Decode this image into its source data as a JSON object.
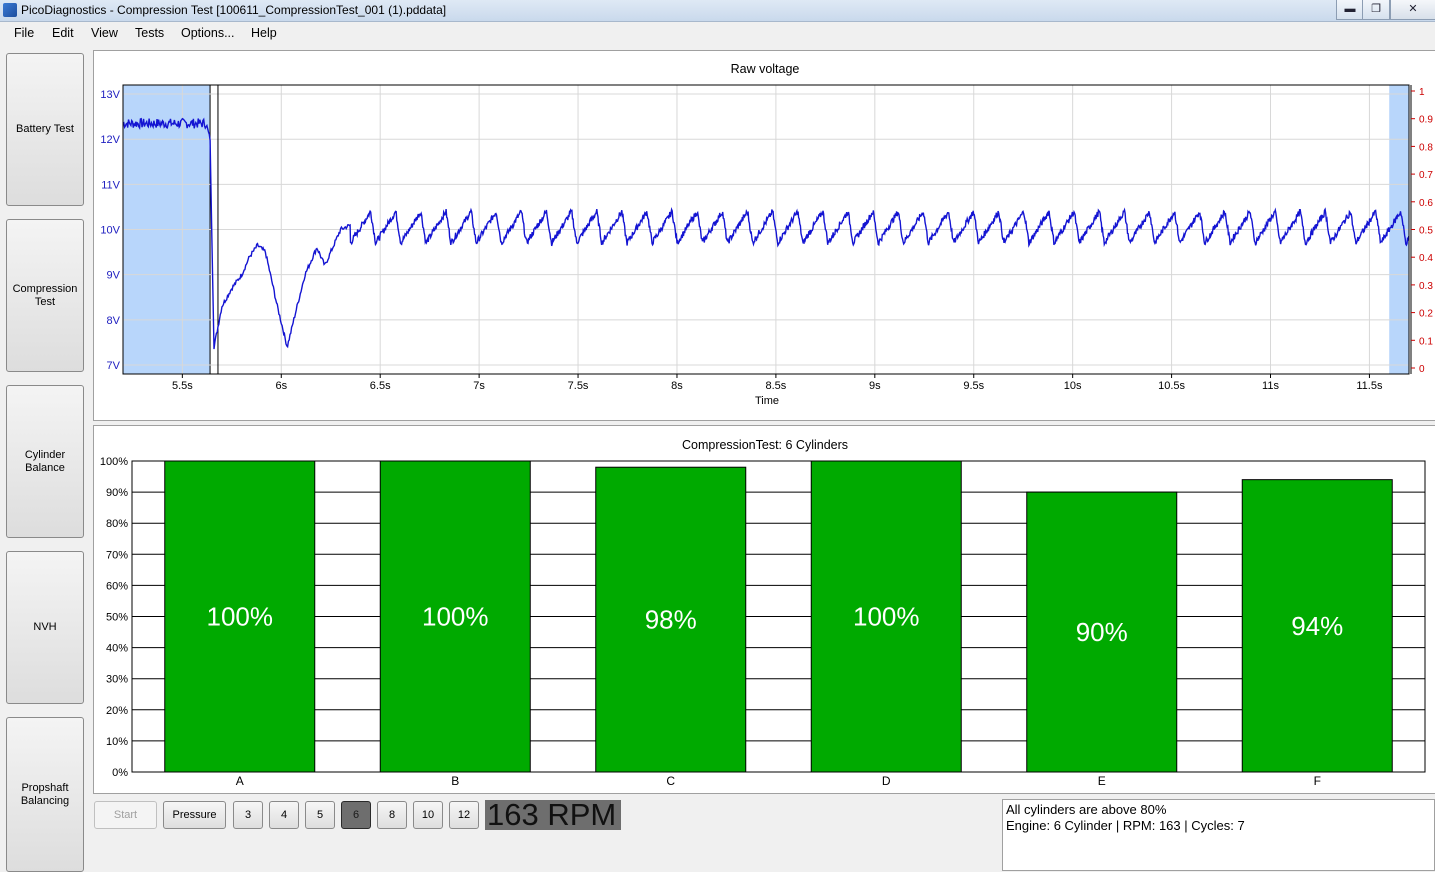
{
  "window": {
    "title": "PicoDiagnostics - Compression Test [100611_CompressionTest_001 (1).pddata]",
    "minimize": "▬",
    "maximize": "❐",
    "close": "✕"
  },
  "menu": [
    "File",
    "Edit",
    "View",
    "Tests",
    "Options...",
    "Help"
  ],
  "sidebar": [
    "Battery Test",
    "Compression\nTest",
    "Cylinder\nBalance",
    "NVH",
    "Propshaft\nBalancing"
  ],
  "colors": {
    "trace": "#1414d2",
    "bar": "#00aa00",
    "left_axis": "#2020c0",
    "right_axis": "#cc0000",
    "selection": "#b8d6fb"
  },
  "chart_data": [
    {
      "type": "line",
      "title": "Raw voltage",
      "xlabel": "Time",
      "ylabel": "",
      "xlim": [
        5.2,
        11.7
      ],
      "ylim": [
        6.8,
        13.2
      ],
      "x_ticks": [
        "5.5s",
        "6s",
        "6.5s",
        "7s",
        "7.5s",
        "8s",
        "8.5s",
        "9s",
        "9.5s",
        "10s",
        "10.5s",
        "11s",
        "11.5s"
      ],
      "x_tick_values": [
        5.5,
        6,
        6.5,
        7,
        7.5,
        8,
        8.5,
        9,
        9.5,
        10,
        10.5,
        11,
        11.5
      ],
      "y_ticks": [
        "13V",
        "12V",
        "11V",
        "10V",
        "9V",
        "8V",
        "7V"
      ],
      "y_tick_values": [
        13,
        12,
        11,
        10,
        9,
        8,
        7
      ],
      "y2_ticks": [
        "1",
        "0.9",
        "0.8",
        "0.7",
        "0.6",
        "0.5",
        "0.4",
        "0.3",
        "0.2",
        "0.1",
        "0"
      ],
      "y2_tick_values": [
        1,
        0.9,
        0.8,
        0.7,
        0.6,
        0.5,
        0.4,
        0.3,
        0.2,
        0.1,
        0
      ],
      "grid": true,
      "series": [
        {
          "x": [
            5.2,
            5.62,
            5.64,
            5.66,
            5.7,
            5.75,
            5.8,
            5.84,
            5.88,
            5.92,
            5.98,
            6.03,
            6.08,
            6.12,
            6.18,
            6.22,
            6.3,
            6.35
          ],
          "y": [
            12.35,
            12.35,
            12.0,
            7.4,
            8.3,
            8.7,
            9.0,
            9.4,
            9.65,
            9.5,
            8.3,
            7.4,
            8.3,
            9.0,
            9.6,
            9.2,
            10.0,
            10.1
          ],
          "oscillation": {
            "from": 6.35,
            "to": 11.7,
            "period": 0.127,
            "trough": 9.7,
            "peak": 10.4
          }
        }
      ],
      "selections": [
        [
          5.2,
          5.64
        ],
        [
          11.6,
          11.7
        ]
      ],
      "cursor": 5.68
    },
    {
      "type": "bar",
      "title": "CompressionTest: 6 Cylinders",
      "categories": [
        "A",
        "B",
        "C",
        "D",
        "E",
        "F"
      ],
      "values": [
        100,
        100,
        98,
        100,
        90,
        94
      ],
      "labels": [
        "100%",
        "100%",
        "98%",
        "100%",
        "90%",
        "94%"
      ],
      "ylim": [
        0,
        100
      ],
      "y_ticks": [
        "100%",
        "90%",
        "80%",
        "70%",
        "60%",
        "50%",
        "40%",
        "30%",
        "20%",
        "10%",
        "0%"
      ],
      "y_tick_values": [
        100,
        90,
        80,
        70,
        60,
        50,
        40,
        30,
        20,
        10,
        0
      ],
      "grid": true
    }
  ],
  "controls": {
    "start": "Start",
    "pressure": "Pressure",
    "cylinder_options": [
      "3",
      "4",
      "5",
      "6",
      "8",
      "10",
      "12"
    ],
    "selected_cylinders": "6",
    "rpm": "163 RPM"
  },
  "status": {
    "line1": "All cylinders are above 80%",
    "line2": "Engine: 6 Cylinder | RPM: 163 | Cycles: 7"
  }
}
